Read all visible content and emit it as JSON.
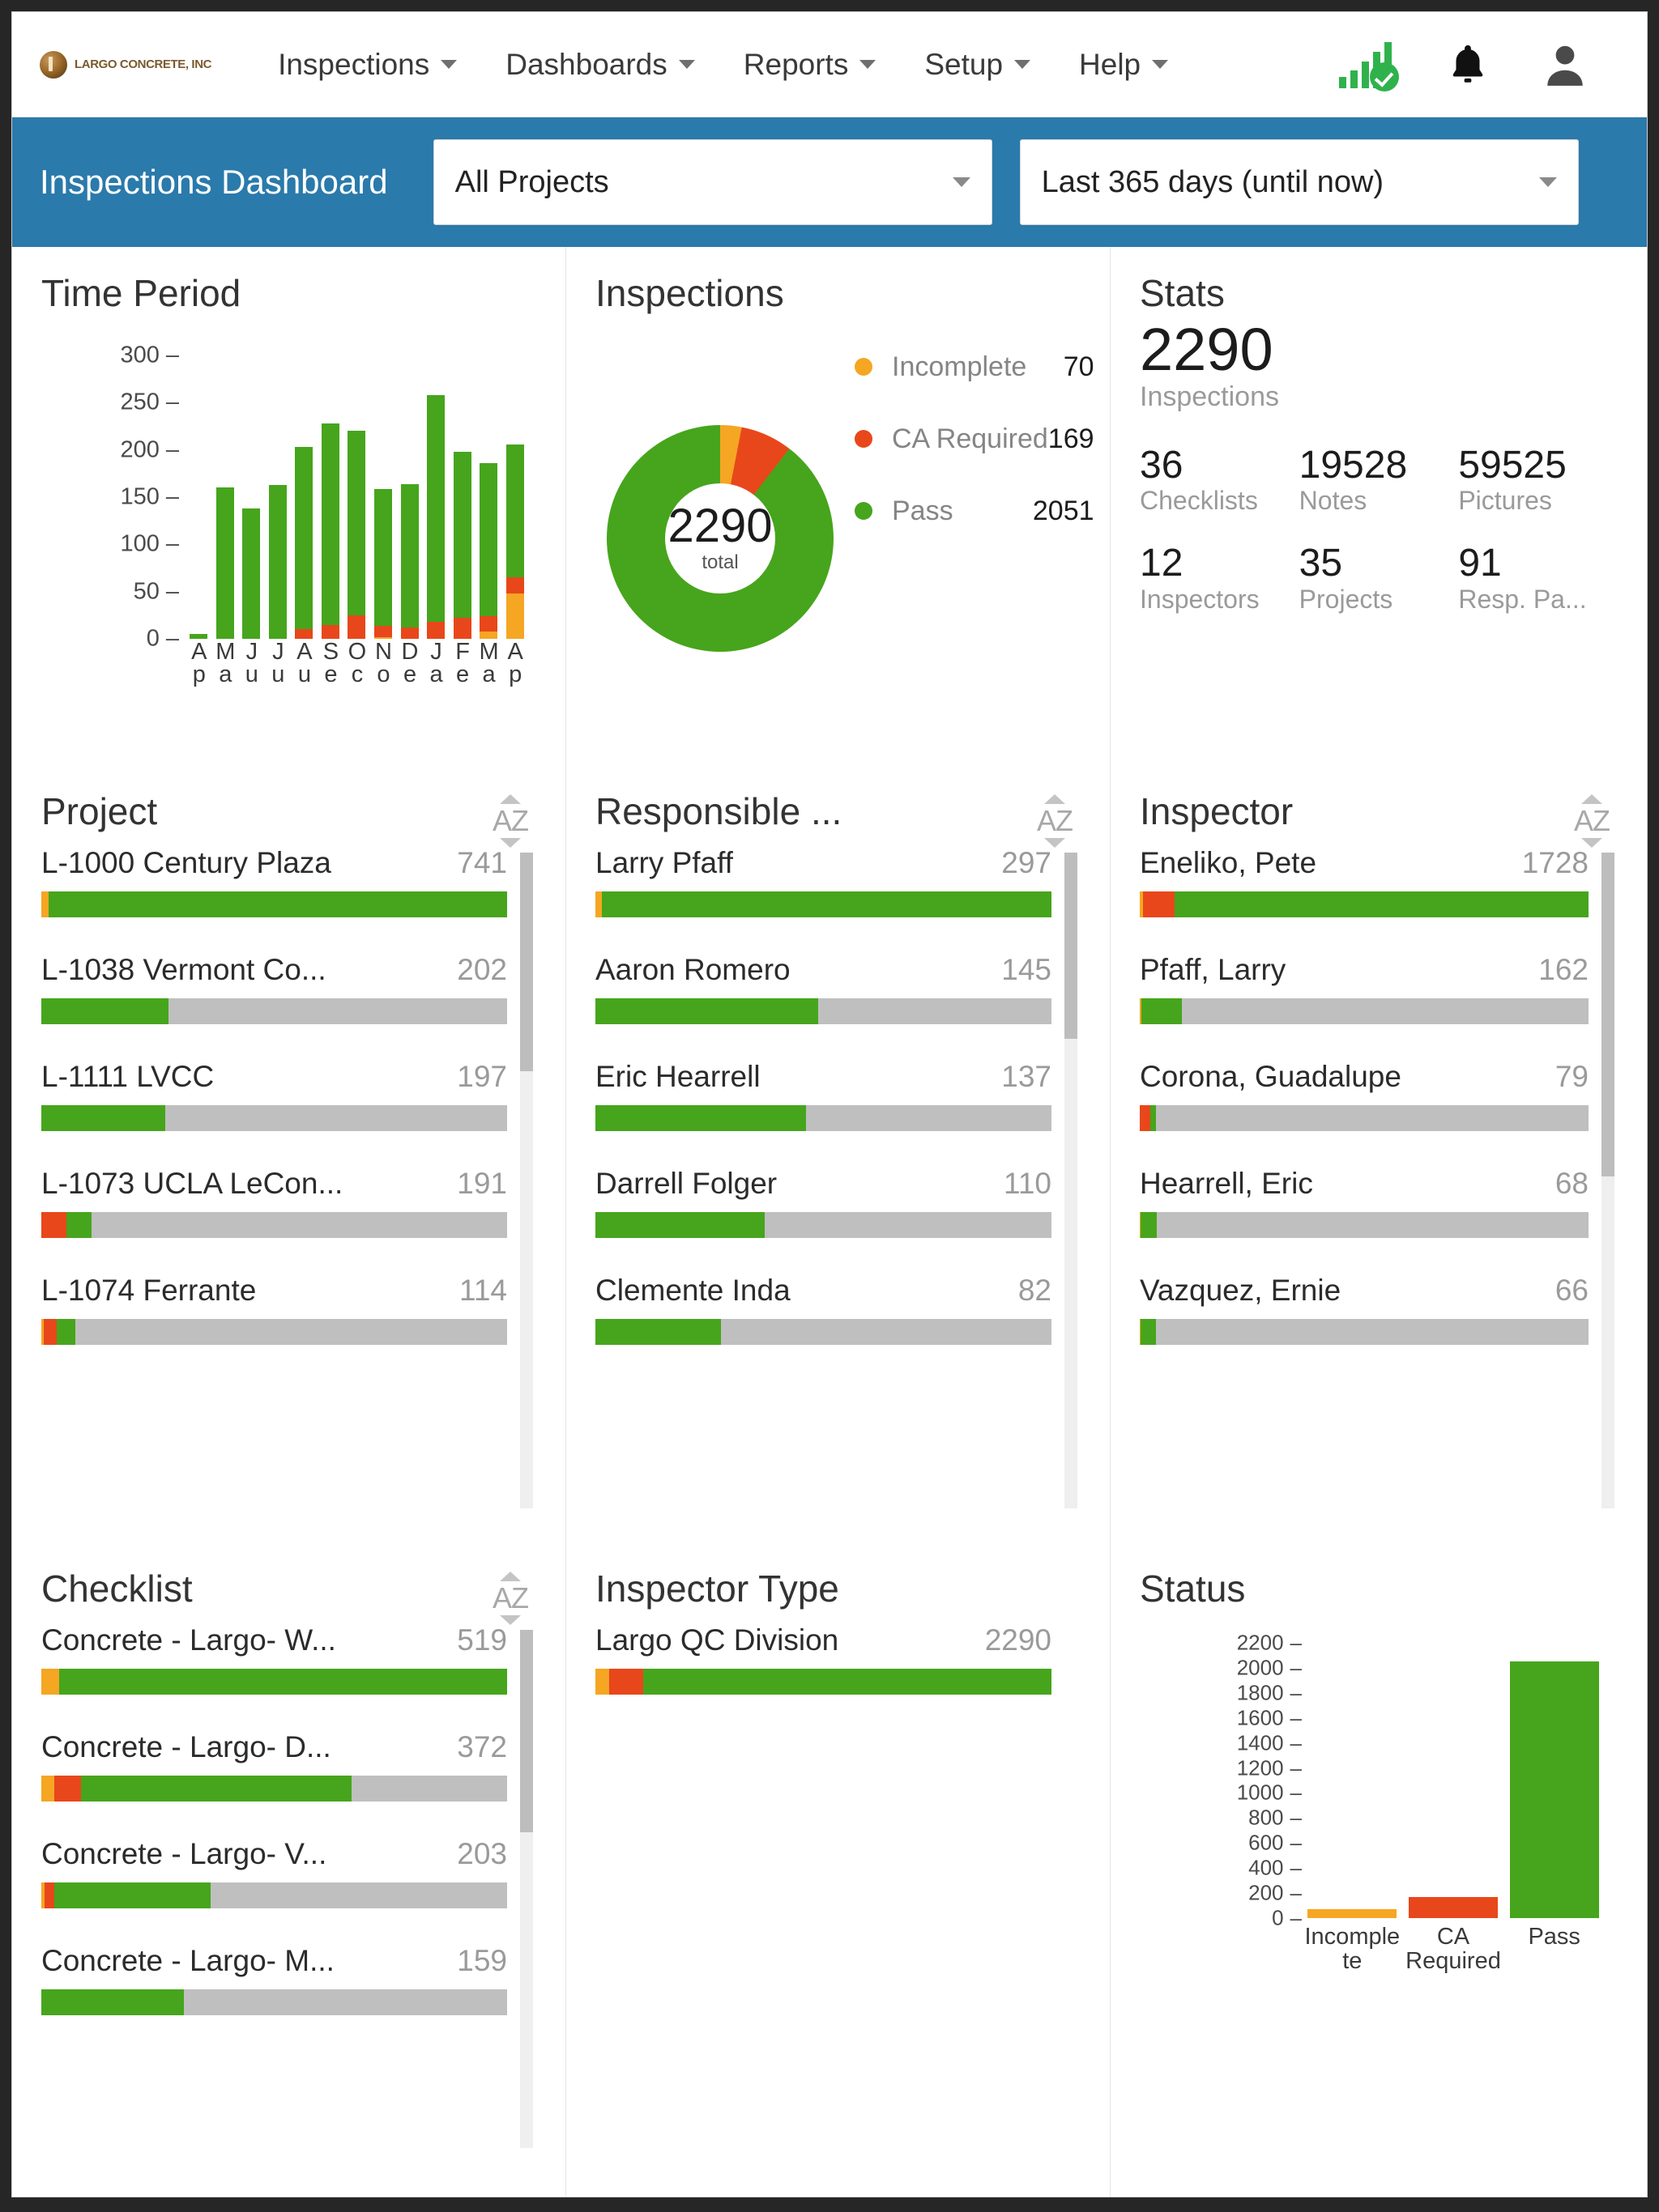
{
  "brand": {
    "logo_text": "LARGO CONCRETE, INC"
  },
  "nav": {
    "items": [
      {
        "label": "Inspections"
      },
      {
        "label": "Dashboards"
      },
      {
        "label": "Reports"
      },
      {
        "label": "Setup"
      },
      {
        "label": "Help"
      }
    ],
    "icons": [
      "signal-check-icon",
      "bell-icon",
      "user-avatar-icon"
    ]
  },
  "filterbar": {
    "title": "Inspections Dashboard",
    "project_select": "All Projects",
    "range_select": "Last 365 days (until now)"
  },
  "colors": {
    "accent_blue": "#2a7aab",
    "pass_green": "#46a51c",
    "ca_red": "#e8471b",
    "incomplete_orange": "#f5a623",
    "track_grey": "#bfbfbf"
  },
  "panels": {
    "time_period": {
      "title": "Time Period"
    },
    "inspections": {
      "title": "Inspections",
      "center_total": "2290",
      "center_sub": "total"
    },
    "stats": {
      "title": "Stats",
      "headline_value": "2290",
      "headline_label": "Inspections",
      "items": [
        {
          "value": "36",
          "label": "Checklists"
        },
        {
          "value": "19528",
          "label": "Notes"
        },
        {
          "value": "59525",
          "label": "Pictures"
        },
        {
          "value": "12",
          "label": "Inspectors"
        },
        {
          "value": "35",
          "label": "Projects"
        },
        {
          "value": "91",
          "label": "Resp. Pa..."
        }
      ]
    },
    "project": {
      "title": "Project",
      "sort_icon": "sort-az-icon"
    },
    "responsible": {
      "title": "Responsible ...",
      "sort_icon": "sort-az-icon"
    },
    "inspector": {
      "title": "Inspector",
      "sort_icon": "sort-az-icon"
    },
    "checklist": {
      "title": "Checklist",
      "sort_icon": "sort-az-icon"
    },
    "inspector_type": {
      "title": "Inspector Type"
    },
    "status": {
      "title": "Status"
    }
  },
  "lists": {
    "project": [
      {
        "name": "L-1000 Century Plaza",
        "value": "741",
        "incomplete": 12,
        "ca": 0,
        "pass": 729
      },
      {
        "name": "L-1038 Vermont Co...",
        "value": "202",
        "incomplete": 0,
        "ca": 0,
        "pass": 202
      },
      {
        "name": "L-1111 LVCC",
        "value": "197",
        "incomplete": 0,
        "ca": 0,
        "pass": 197
      },
      {
        "name": "L-1073 UCLA LeCon...",
        "value": "191",
        "incomplete": 0,
        "ca": 40,
        "pass": 40
      },
      {
        "name": "L-1074 Ferrante",
        "value": "114",
        "incomplete": 4,
        "ca": 20,
        "pass": 30
      }
    ],
    "responsible": [
      {
        "name": "Larry Pfaff",
        "value": "297",
        "incomplete": 4,
        "ca": 0,
        "pass": 293
      },
      {
        "name": "Aaron Romero",
        "value": "145",
        "incomplete": 0,
        "ca": 0,
        "pass": 145
      },
      {
        "name": "Eric Hearrell",
        "value": "137",
        "incomplete": 0,
        "ca": 0,
        "pass": 137
      },
      {
        "name": "Darrell Folger",
        "value": "110",
        "incomplete": 0,
        "ca": 0,
        "pass": 110
      },
      {
        "name": "Clemente Inda",
        "value": "82",
        "incomplete": 0,
        "ca": 0,
        "pass": 82
      }
    ],
    "inspector": [
      {
        "name": "Eneliko, Pete",
        "value": "1728",
        "incomplete": 14,
        "ca": 120,
        "pass": 1594
      },
      {
        "name": "Pfaff, Larry",
        "value": "162",
        "incomplete": 6,
        "ca": 0,
        "pass": 156
      },
      {
        "name": "Corona, Guadalupe",
        "value": "79",
        "incomplete": 0,
        "ca": 40,
        "pass": 22
      },
      {
        "name": "Hearrell, Eric",
        "value": "68",
        "incomplete": 4,
        "ca": 0,
        "pass": 60
      },
      {
        "name": "Vazquez, Ernie",
        "value": "66",
        "incomplete": 4,
        "ca": 0,
        "pass": 58
      }
    ],
    "checklist": [
      {
        "name": "Concrete - Largo- W...",
        "value": "519",
        "incomplete": 20,
        "ca": 0,
        "pass": 499
      },
      {
        "name": "Concrete - Largo- D...",
        "value": "372",
        "incomplete": 14,
        "ca": 30,
        "pass": 302
      },
      {
        "name": "Concrete - Largo- V...",
        "value": "203",
        "incomplete": 4,
        "ca": 10,
        "pass": 175
      },
      {
        "name": "Concrete - Largo- M...",
        "value": "159",
        "incomplete": 0,
        "ca": 0,
        "pass": 159
      }
    ],
    "inspector_type": [
      {
        "name": "Largo QC Division",
        "value": "2290",
        "incomplete": 70,
        "ca": 169,
        "pass": 2051
      }
    ]
  },
  "chart_data": [
    {
      "type": "bar",
      "id": "time-period",
      "title": "Time Period",
      "stacked": true,
      "categories": [
        "Apr",
        "May",
        "Jun",
        "Jul",
        "Aug",
        "Sep",
        "Oct",
        "Nov",
        "Dec",
        "Jan",
        "Feb",
        "Mar",
        "Apr"
      ],
      "series": [
        {
          "name": "Incomplete",
          "color": "#f5a623",
          "values": [
            0,
            0,
            0,
            0,
            0,
            0,
            0,
            2,
            0,
            0,
            0,
            8,
            48
          ]
        },
        {
          "name": "CA Required",
          "color": "#e8471b",
          "values": [
            0,
            0,
            0,
            0,
            10,
            15,
            25,
            12,
            12,
            18,
            22,
            16,
            17
          ]
        },
        {
          "name": "Pass",
          "color": "#46a51c",
          "values": [
            5,
            160,
            138,
            163,
            193,
            213,
            195,
            145,
            152,
            240,
            176,
            162,
            141
          ]
        }
      ],
      "totals": [
        5,
        160,
        138,
        163,
        203,
        228,
        220,
        159,
        164,
        258,
        198,
        186,
        206
      ],
      "xlabel": "",
      "ylabel": "",
      "ylim": [
        0,
        300
      ],
      "yticks": [
        0,
        50,
        100,
        150,
        200,
        250,
        300
      ],
      "grid": false,
      "legend": "none"
    },
    {
      "type": "pie",
      "id": "inspections-donut",
      "title": "Inspections",
      "donut": true,
      "center_label": "2290",
      "center_sublabel": "total",
      "labels": [
        "Incomplete",
        "CA Required",
        "Pass"
      ],
      "values": [
        70,
        169,
        2051
      ],
      "colors": [
        "#f5a623",
        "#e8471b",
        "#46a51c"
      ],
      "legend": "right"
    },
    {
      "type": "bar",
      "id": "status",
      "title": "Status",
      "categories": [
        "Incomplete",
        "CA Required",
        "Pass"
      ],
      "values": [
        70,
        169,
        2051
      ],
      "colors": [
        "#f5a623",
        "#e8471b",
        "#46a51c"
      ],
      "xlabel": "",
      "ylabel": "",
      "ylim": [
        0,
        2200
      ],
      "yticks": [
        0,
        200,
        400,
        600,
        800,
        1000,
        1200,
        1400,
        1600,
        1800,
        2000,
        2200
      ],
      "grid": false,
      "legend": "none"
    }
  ]
}
